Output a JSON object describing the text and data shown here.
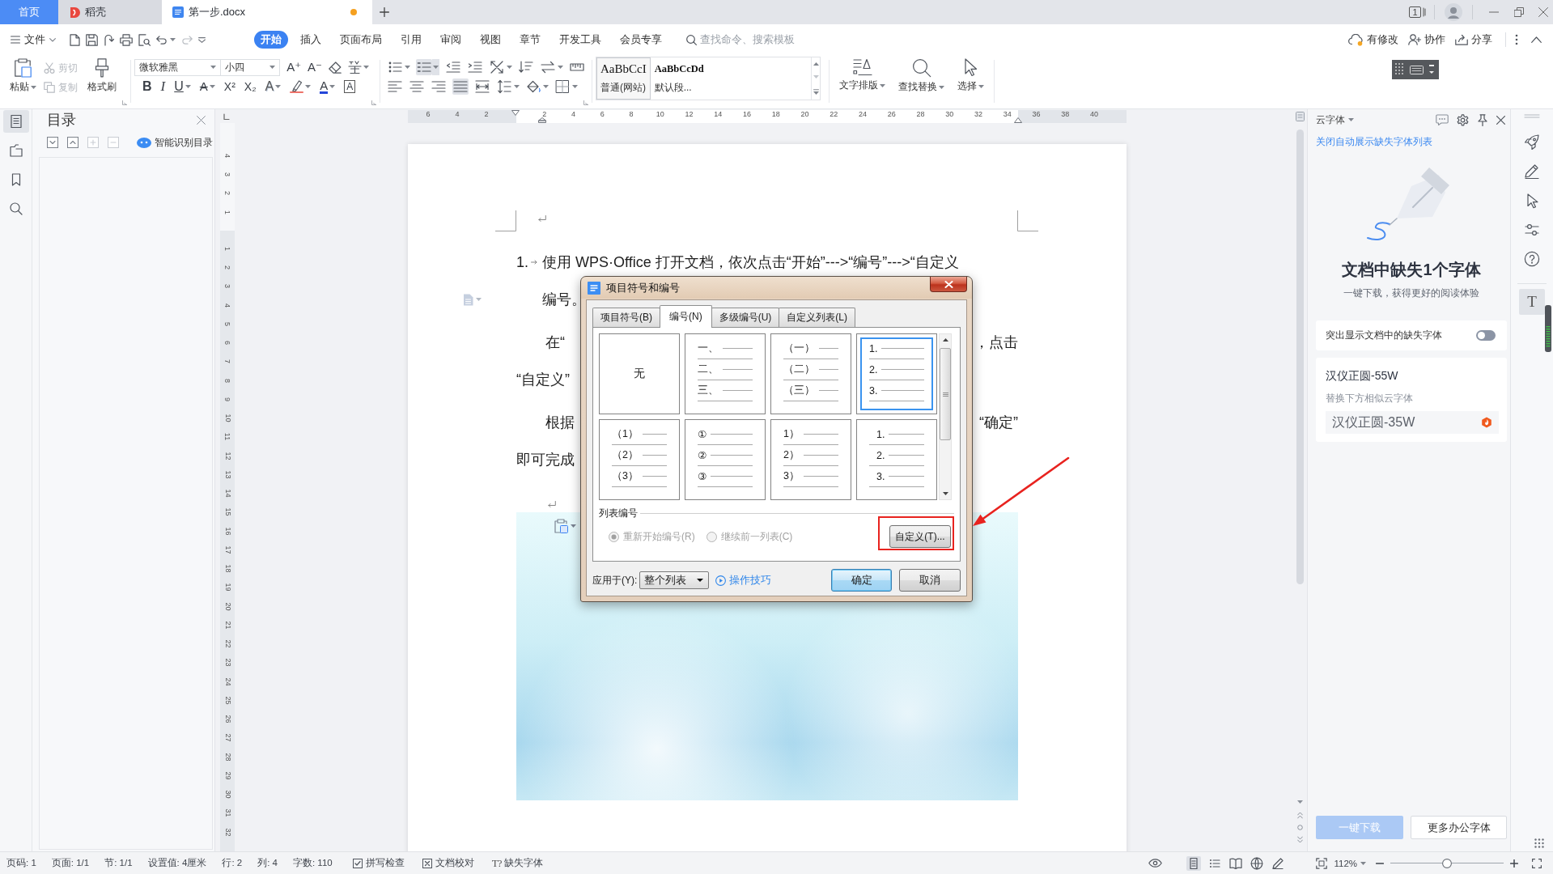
{
  "tab_bar": {
    "tabs": [
      {
        "label": "首页",
        "kind": "home",
        "selected": false
      },
      {
        "label": "稻壳",
        "kind": "docer",
        "selected": false
      },
      {
        "label": "第一步.docx",
        "kind": "document",
        "selected": true,
        "modified": true
      }
    ],
    "window_count": "1"
  },
  "menu_bar": {
    "file_menu": "文件",
    "ribbon_tabs": [
      {
        "label": "开始",
        "selected": true
      },
      {
        "label": "插入",
        "selected": false
      },
      {
        "label": "页面布局",
        "selected": false
      },
      {
        "label": "引用",
        "selected": false
      },
      {
        "label": "审阅",
        "selected": false
      },
      {
        "label": "视图",
        "selected": false
      },
      {
        "label": "章节",
        "selected": false
      },
      {
        "label": "开发工具",
        "selected": false
      },
      {
        "label": "会员专享",
        "selected": false
      }
    ],
    "search": {
      "placeholder": "查找命令、搜索模板"
    },
    "actions": [
      {
        "label": "有修改",
        "kind": "cloud"
      },
      {
        "label": "协作",
        "kind": "collaborate"
      },
      {
        "label": "分享",
        "kind": "share"
      }
    ]
  },
  "ribbon": {
    "clipboard": {
      "paste": "粘贴",
      "edit_tools": [
        {
          "label": "剪切",
          "kind": "cut",
          "disabled": true
        },
        {
          "label": "复制",
          "kind": "copy",
          "disabled": true
        }
      ],
      "format_painter": "格式刷"
    },
    "font": {
      "name": "微软雅黑",
      "size": "小四",
      "tools": [
        [
          {
            "kind": "grow",
            "glyph": "A⁺"
          },
          {
            "kind": "shrink",
            "glyph": "A⁻"
          },
          {
            "kind": "clear"
          },
          {
            "kind": "phonetic"
          }
        ],
        [
          {
            "kind": "bold",
            "glyph": "B"
          },
          {
            "kind": "italic",
            "glyph": "I"
          },
          {
            "kind": "underline",
            "glyph": "U"
          },
          {
            "kind": "strike",
            "glyph": "A"
          },
          {
            "kind": "superscript",
            "glyph": "X²"
          },
          {
            "kind": "subscript",
            "glyph": "X₂"
          },
          {
            "kind": "effect",
            "glyph": "A"
          },
          {
            "kind": "highlight"
          },
          {
            "kind": "color",
            "glyph": "A"
          },
          {
            "kind": "border",
            "glyph": "A"
          }
        ]
      ]
    },
    "paragraph": {
      "tools": [
        [
          {
            "kind": "bullets",
            "selected": false
          },
          {
            "kind": "numbering",
            "selected": true
          },
          {
            "kind": "outdent",
            "selected": false
          },
          {
            "kind": "indent",
            "selected": false
          },
          {
            "kind": "chinese-layout",
            "selected": false
          },
          {
            "kind": "sort",
            "selected": false
          },
          {
            "kind": "direction",
            "selected": false
          },
          {
            "kind": "tabs",
            "selected": false
          }
        ],
        [
          {
            "kind": "align-left",
            "selected": false
          },
          {
            "kind": "align-center",
            "selected": false
          },
          {
            "kind": "align-right",
            "selected": false
          },
          {
            "kind": "justify",
            "selected": true
          },
          {
            "kind": "distribute",
            "selected": false
          },
          {
            "kind": "line-spacing",
            "selected": false
          },
          {
            "kind": "shading",
            "selected": false
          },
          {
            "kind": "borders",
            "selected": false
          }
        ]
      ]
    },
    "styles": [
      {
        "sample": "AaBbCcI",
        "name": "普通(网站)",
        "selected": true
      },
      {
        "sample": "AaBbCcDd",
        "name": "默认段...",
        "selected": false
      }
    ],
    "tools": [
      {
        "label": "文字排版",
        "kind": "text-layout"
      },
      {
        "label": "查找替换",
        "kind": "find-replace"
      },
      {
        "label": "选择",
        "kind": "select"
      }
    ]
  },
  "left_bar": [
    {
      "kind": "outline",
      "selected": true
    },
    {
      "kind": "navigation",
      "selected": false
    },
    {
      "kind": "bookmark",
      "selected": false
    },
    {
      "kind": "search",
      "selected": false
    }
  ],
  "outline_panel": {
    "title": "目录",
    "tools": [
      {
        "kind": "expand",
        "disabled": false
      },
      {
        "kind": "collapse",
        "disabled": false
      },
      {
        "kind": "add",
        "disabled": true
      },
      {
        "kind": "remove",
        "disabled": true
      }
    ],
    "smart_button": "智能识别目录"
  },
  "rulers": {
    "horizontal_before": [
      "6",
      "4",
      "2"
    ],
    "horizontal_after": [
      "2",
      "4",
      "6",
      "8",
      "10",
      "12",
      "14",
      "16",
      "18",
      "20",
      "22",
      "24",
      "26",
      "28",
      "30",
      "32",
      "34",
      "36",
      "38",
      "40"
    ],
    "vertical_before": [
      "4",
      "3",
      "2",
      "1"
    ],
    "vertical_after": [
      "1",
      "2",
      "3",
      "4",
      "5",
      "6",
      "7",
      "8",
      "9",
      "10",
      "11",
      "12",
      "13",
      "14",
      "15",
      "16",
      "17",
      "18",
      "19",
      "20",
      "21",
      "22",
      "23",
      "24",
      "25",
      "26",
      "27",
      "28",
      "29",
      "30",
      "31",
      "32"
    ]
  },
  "document": {
    "lines": [
      {
        "kind": "numbered",
        "number": "1.",
        "text": "使用 WPS·Office 打开文档，依次点击“开始”--->“编号”--->“自定义"
      },
      {
        "kind": "hanging",
        "text": "编号。"
      },
      {
        "kind": "indented",
        "text": "在“",
        "right": "，点击"
      },
      {
        "kind": "body",
        "text": "“自定义”"
      },
      {
        "kind": "indented",
        "text": "根据",
        "right": "“确定”"
      },
      {
        "kind": "body",
        "text": "即可完成"
      }
    ]
  },
  "dialog": {
    "title": "项目符号和编号",
    "tabs": [
      {
        "label": "项目符号(B)",
        "selected": false
      },
      {
        "label": "编号(N)",
        "selected": true
      },
      {
        "label": "多级编号(U)",
        "selected": false
      },
      {
        "label": "自定义列表(L)",
        "selected": false
      }
    ],
    "styles": [
      {
        "kind": "none",
        "labels": [
          "无"
        ],
        "selected": false
      },
      {
        "kind": "numbered",
        "labels": [
          "一、",
          "二、",
          "三、"
        ],
        "selected": false
      },
      {
        "kind": "numbered",
        "labels": [
          "（一）",
          "（二）",
          "（三）"
        ],
        "selected": false
      },
      {
        "kind": "numbered",
        "labels": [
          "1.",
          "2.",
          "3."
        ],
        "selected": true
      },
      {
        "kind": "numbered",
        "labels": [
          "（1）",
          "（2）",
          "（3）"
        ],
        "selected": false
      },
      {
        "kind": "numbered",
        "labels": [
          "①",
          "②",
          "③"
        ],
        "selected": false
      },
      {
        "kind": "numbered",
        "labels": [
          "1）",
          "2）",
          "3）"
        ],
        "selected": false
      },
      {
        "kind": "indented",
        "labels": [
          "1.",
          "2.",
          "3."
        ],
        "selected": false
      }
    ],
    "list_numbering": {
      "label": "列表编号",
      "options": [
        {
          "label": "重新开始编号(R)",
          "selected": true,
          "disabled": true
        },
        {
          "label": "继续前一列表(C)",
          "selected": false,
          "disabled": true
        }
      ],
      "customize": "自定义(T)..."
    },
    "apply_to": {
      "label": "应用于(Y):",
      "value": "整个列表"
    },
    "tips": "操作技巧",
    "buttons": [
      {
        "label": "确定",
        "kind": "default"
      },
      {
        "label": "取消",
        "kind": "cancel"
      }
    ]
  },
  "cloud_fonts": {
    "title": "云字体",
    "link": "关闭自动展示缺失字体列表",
    "heading": "文档中缺失1个字体",
    "subheading": "一键下载，获得更好的阅读体验",
    "toggle": {
      "label": "突出显示文档中的缺失字体",
      "on": false
    },
    "missing_font": {
      "name": "汉仪正圆-55W",
      "hint": "替换下方相似云字体",
      "replacement": "汉仪正圆-35W"
    },
    "buttons": [
      {
        "label": "一键下载",
        "kind": "primary",
        "disabled": true
      },
      {
        "label": "更多办公字体",
        "kind": "secondary",
        "disabled": false
      }
    ]
  },
  "side_tools": [
    {
      "kind": "rocket",
      "selected": false
    },
    {
      "kind": "pen",
      "selected": false
    },
    {
      "kind": "cursor",
      "selected": false
    },
    {
      "kind": "sliders",
      "selected": false
    },
    {
      "kind": "help",
      "selected": false
    },
    {
      "kind": "text",
      "glyph": "T",
      "selected": true
    }
  ],
  "status_bar": {
    "fields": [
      "页码: 1",
      "页面: 1/1",
      "节: 1/1",
      "设置值: 4厘米",
      "行: 2",
      "列: 4",
      "字数: 110"
    ],
    "checks": [
      {
        "label": "拼写检查",
        "kind": "spell"
      },
      {
        "label": "文档校对",
        "kind": "proofread"
      },
      {
        "label": "缺失字体",
        "kind": "missing-font",
        "glyph": "T?"
      }
    ],
    "views": [
      {
        "kind": "page",
        "selected": true
      },
      {
        "kind": "outline",
        "selected": false
      },
      {
        "kind": "reading",
        "selected": false
      },
      {
        "kind": "web",
        "selected": false
      },
      {
        "kind": "pen",
        "selected": false
      }
    ],
    "zoom": {
      "value": "112%",
      "level": 0.5
    }
  }
}
